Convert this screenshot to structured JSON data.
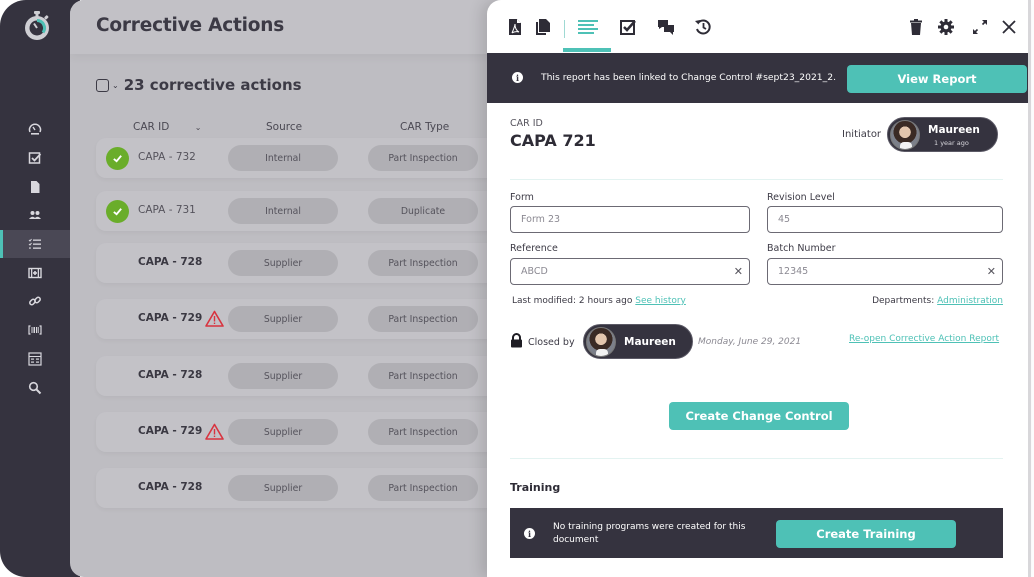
{
  "sidebar": {
    "logo_icon": "stopwatch-logo-icon",
    "items": [
      {
        "icon": "dashboard-gauge-icon",
        "active": false
      },
      {
        "icon": "checkbox-task-icon",
        "active": false
      },
      {
        "icon": "document-icon",
        "active": false
      },
      {
        "icon": "users-icon",
        "active": false
      },
      {
        "icon": "checklist-icon",
        "active": true
      },
      {
        "icon": "medical-kit-icon",
        "active": false
      },
      {
        "icon": "link-icon",
        "active": false
      },
      {
        "icon": "barcode-icon",
        "active": false
      },
      {
        "icon": "form-grid-icon",
        "active": false
      },
      {
        "icon": "search-icon",
        "active": false
      }
    ]
  },
  "main": {
    "title": "Corrective Actions",
    "count_label": "23 corrective actions",
    "columns": {
      "car_id": "CAR ID",
      "source": "Source",
      "car_type": "CAR Type"
    },
    "rows": [
      {
        "id": "CAPA - 732",
        "status": "completed",
        "source": "Internal",
        "type": "Part Inspection"
      },
      {
        "id": "CAPA - 731",
        "status": "completed",
        "source": "Internal",
        "type": "Duplicate"
      },
      {
        "id": "CAPA - 728",
        "status": "none",
        "source": "Supplier",
        "type": "Part Inspection"
      },
      {
        "id": "CAPA - 729",
        "status": "warning",
        "source": "Supplier",
        "type": "Part Inspection"
      },
      {
        "id": "CAPA - 728",
        "status": "none",
        "source": "Supplier",
        "type": "Part Inspection"
      },
      {
        "id": "CAPA - 729",
        "status": "warning",
        "source": "Supplier",
        "type": "Part Inspection"
      },
      {
        "id": "CAPA - 728",
        "status": "none",
        "source": "Supplier",
        "type": "Part Inspection"
      }
    ]
  },
  "panel": {
    "toolbar": {
      "left": [
        "pdf-icon",
        "copy-icon",
        "details-lines-icon",
        "checklist-icon",
        "comments-icon",
        "history-icon"
      ],
      "right": [
        "trash-icon",
        "gear-icon",
        "expand-icon",
        "close-icon"
      ]
    },
    "linked_notice": {
      "text": "This report has been linked to Change Control #sept23_2021_2.",
      "button": "View Report"
    },
    "car_id_label": "CAR ID",
    "car_id_value": "CAPA 721",
    "initiator": {
      "label": "Initiator",
      "name": "Maureen",
      "time": "1 year ago"
    },
    "fields": {
      "form": {
        "label": "Form",
        "value": "Form 23"
      },
      "revision": {
        "label": "Revision Level",
        "value": "45"
      },
      "reference": {
        "label": "Reference",
        "value": "ABCD"
      },
      "batch": {
        "label": "Batch Number",
        "value": "12345"
      }
    },
    "last_modified": "Last modified: 2 hours ago",
    "see_history": "See history",
    "departments_label": "Departments:",
    "departments_value": "Administration",
    "closed": {
      "label": "Closed by",
      "name": "Maureen",
      "date": "Monday, June 29, 2021",
      "reopen_link": "Re-open Corrective Action Report"
    },
    "create_change_control": "Create Change Control",
    "training": {
      "title": "Training",
      "notice": "No training programs were created for this document",
      "button": "Create Training"
    }
  },
  "colors": {
    "accent": "#4ec1b6",
    "dark": "#35333f",
    "success": "#6aad2a",
    "warning": "#d8333f"
  }
}
